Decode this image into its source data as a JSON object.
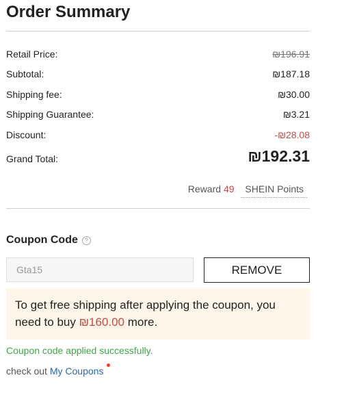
{
  "order_summary": {
    "title": "Order Summary",
    "rows": [
      {
        "label": "Retail Price:",
        "value": "₪196.91"
      },
      {
        "label": "Subtotal:",
        "value": "₪187.18"
      },
      {
        "label": "Shipping fee:",
        "value": "₪30.00"
      },
      {
        "label": "Shipping Guarantee:",
        "value": "₪3.21"
      },
      {
        "label": "Discount:",
        "value": "-₪28.08"
      }
    ],
    "grand_total": {
      "label": "Grand Total:",
      "value": "₪192.31"
    },
    "reward": {
      "prefix": "Reward",
      "points": "49",
      "suffix": "SHEIN Points"
    }
  },
  "coupon": {
    "title": "Coupon Code",
    "help_icon": "question-circle-icon",
    "input_value": "Gta15",
    "remove_label": "REMOVE",
    "notice": {
      "text_before": "To get free shipping after applying the coupon, you need to buy ",
      "amount": "₪160.00",
      "text_after": " more."
    },
    "success_message": "Coupon code applied successfully.",
    "checkout_prefix": "check out",
    "my_coupons_link": "My Coupons"
  },
  "colors": {
    "accent_red": "#c44a4a",
    "success_green": "#3fa84a",
    "link_blue": "#2d68a8",
    "notice_bg": "#fff6e9",
    "notification_dot": "#fe3b30"
  }
}
